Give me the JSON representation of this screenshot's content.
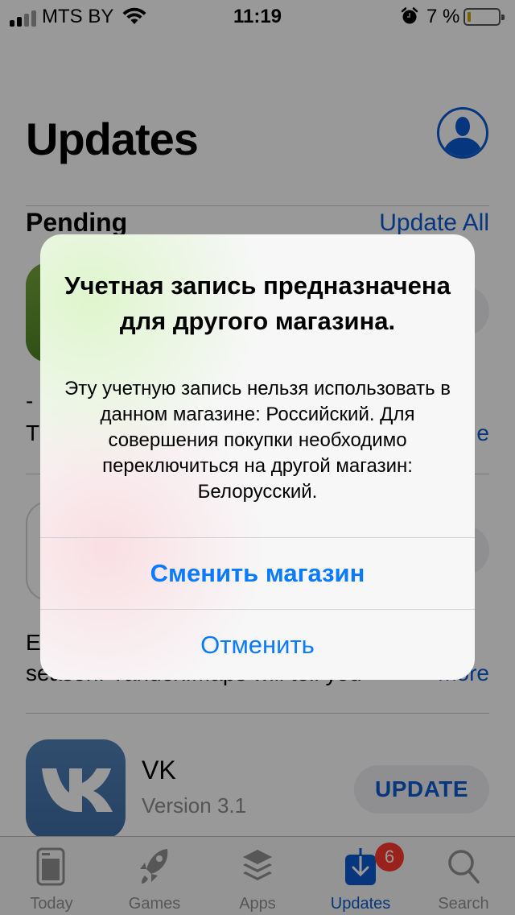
{
  "status_bar": {
    "carrier": "MTS BY",
    "time": "11:19",
    "battery_percent_label": "7 %",
    "battery_level": 0.07,
    "signal_bars_active": 2,
    "signal_bars_total": 4
  },
  "header": {
    "title": "Updates",
    "account_icon": "person-circle-icon"
  },
  "section": {
    "title": "Pending",
    "action_label": "Update All"
  },
  "apps": [
    {
      "description_lines": [
        "-",
        "T"
      ],
      "more_label": "e"
    },
    {
      "description_lines": [
        "E",
        "season. Yandex.Maps will tell you"
      ],
      "more_label": "more"
    },
    {
      "name": "VK",
      "version": "Version 3.1",
      "button_label": "UPDATE"
    }
  ],
  "alert": {
    "title": "Учетная запись предназначена для другого магазина.",
    "message": "Эту учетную запись нельзя использовать в данном магазине: Российский. Для совершения покупки необходимо переключиться на другой магазин: Белорусский.",
    "primary_button": "Сменить магазин",
    "cancel_button": "Отменить"
  },
  "tab_bar": {
    "tabs": [
      {
        "label": "Today",
        "icon": "today-icon",
        "active": false
      },
      {
        "label": "Games",
        "icon": "rocket-icon",
        "active": false
      },
      {
        "label": "Apps",
        "icon": "layers-icon",
        "active": false
      },
      {
        "label": "Updates",
        "icon": "download-icon",
        "active": true
      },
      {
        "label": "Search",
        "icon": "search-icon",
        "active": false
      }
    ],
    "updates_badge": "6"
  },
  "colors": {
    "accent": "#0a5bd0",
    "alert_button": "#0a7aff",
    "badge": "#ff3b30"
  }
}
